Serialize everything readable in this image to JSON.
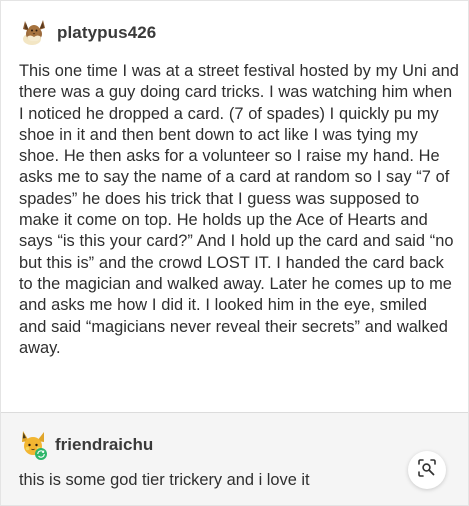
{
  "post": {
    "username": "platypus426",
    "avatar_icon": "eevee-avatar-icon",
    "body": "This one time I was at a street festival hosted by my Uni and there was a guy doing card tricks. I was watching him when I noticed he dropped a card. (7 of spades) I quickly pu my shoe in it and then bent down to act like I was tying my shoe. He then asks for a volunteer so I raise my hand. He asks me to say the name of a card at random so I say “7 of spades” he does his trick that I guess was supposed to make it come on top. He holds up the Ace of Hearts and says “is this your card?” And I hold up the card and said “no but this is” and the crowd LOST IT. I handed the card back to the magician and walked away. Later he comes up to me and asks me how I did it. I looked him in the eye, smiled and said “magicians never reveal their secrets” and walked away."
  },
  "reply": {
    "username": "friendraichu",
    "avatar_icon": "raichu-avatar-icon",
    "body": "this is some god tier trickery and i love it"
  },
  "lens_button_icon": "visual-search-icon",
  "colors": {
    "text": "#2f2f2f",
    "reply_background": "#f5f5f5",
    "divider": "#dcdcdc"
  }
}
